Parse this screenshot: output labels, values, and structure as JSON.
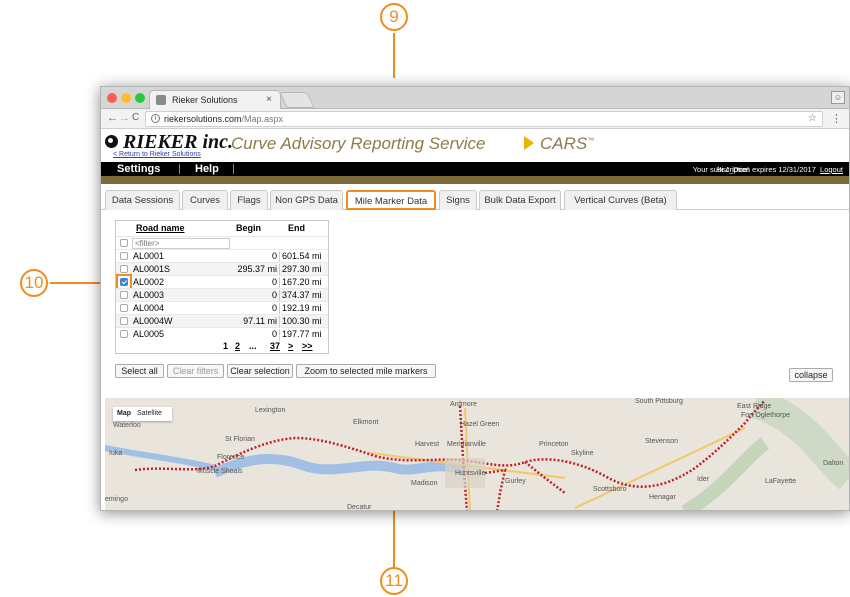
{
  "callouts": {
    "c9": "9",
    "c10": "10",
    "c11": "11"
  },
  "browser": {
    "tab_title": "Rieker Solutions",
    "tab_close": "×",
    "url_prefix": "riekersolutions.com",
    "url_path": "/Map.aspx",
    "back": "←",
    "forward": "→",
    "reload": "C",
    "info": "i",
    "star": "☆",
    "menu": "⋮"
  },
  "header": {
    "logo": "RIEKER inc.",
    "tagline": "Curve Advisory Reporting Service",
    "product": "CARS",
    "trademark": "™",
    "return_link": "< Return to Rieker Solutions"
  },
  "topbar": {
    "settings": "Settings",
    "help": "Help",
    "greeting": "Hi J_Doe!",
    "subscription": "Your subscription expires 12/31/2017",
    "logout": "Logout"
  },
  "tabs": [
    "Data Sessions",
    "Curves",
    "Flags",
    "Non GPS Data",
    "Mile Marker Data",
    "Signs",
    "Bulk Data Export",
    "Vertical Curves (Beta)"
  ],
  "active_tab": "Mile Marker Data",
  "table": {
    "headers": {
      "road": "Road name",
      "begin": "Begin",
      "end": "End"
    },
    "filter_placeholder": "<filter>",
    "rows": [
      {
        "road": "AL0001",
        "begin": "0",
        "end": "601.54 mi",
        "checked": false
      },
      {
        "road": "AL0001S",
        "begin": "295.37 mi",
        "end": "297.30 mi",
        "checked": false
      },
      {
        "road": "AL0002",
        "begin": "0",
        "end": "167.20 mi",
        "checked": true
      },
      {
        "road": "AL0003",
        "begin": "0",
        "end": "374.37 mi",
        "checked": false
      },
      {
        "road": "AL0004",
        "begin": "0",
        "end": "192.19 mi",
        "checked": false
      },
      {
        "road": "AL0004W",
        "begin": "97.11 mi",
        "end": "100.30 mi",
        "checked": false
      },
      {
        "road": "AL0005",
        "begin": "0",
        "end": "197.77 mi",
        "checked": false
      }
    ],
    "pager": {
      "p1": "1",
      "p2": "2",
      "dots": "...",
      "last": "37",
      "next": ">",
      "end": ">>"
    }
  },
  "buttons": {
    "select_all": "Select all",
    "clear_filters": "Clear filters",
    "clear_selection": "Clear selection",
    "zoom": "Zoom to selected mile markers",
    "collapse": "collapse"
  },
  "map": {
    "map_type": "Map",
    "satellite": "Satellite",
    "labels": {
      "waterloo": "Waterloo",
      "lexington": "Lexington",
      "ardmore": "Ardmore",
      "elkmont": "Elkmont",
      "hazel_green": "Hazel Green",
      "south_pittsburg": "South Pittsburg",
      "east_ridge": "East Ridge",
      "fort_oglethorpe": "Fort Oglethorpe",
      "st_florian": "St Florian",
      "harvest": "Harvest",
      "meridianville": "Meridianville",
      "princeton": "Princeton",
      "stevenson": "Stevenson",
      "iuka": "Iuka",
      "florence": "Florence",
      "muscle_shoals": "Muscle Shoals",
      "huntsville": "Huntsville",
      "skyline": "Skyline",
      "ider": "Ider",
      "gurley": "Gurley",
      "madison": "Madison",
      "scottsboro": "Scottsboro",
      "henagar": "Henagar",
      "lafayette": "LaFayette",
      "dalton": "Dalton",
      "mingo": "emingo",
      "decatur": "Decatur"
    },
    "route_color": "#c0202a"
  }
}
